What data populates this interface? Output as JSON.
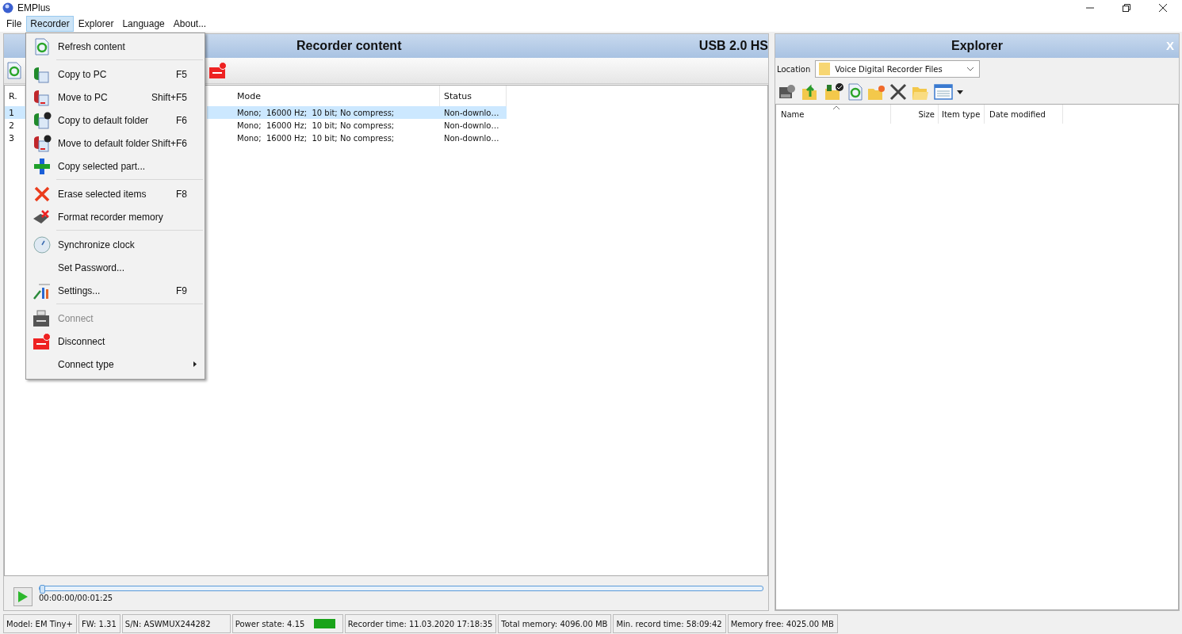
{
  "window": {
    "title": "EMPlus"
  },
  "menu_bar": [
    {
      "label": "File",
      "selected": false
    },
    {
      "label": "Recorder",
      "selected": true
    },
    {
      "label": "Explorer",
      "selected": false
    },
    {
      "label": "Language",
      "selected": false
    },
    {
      "label": "About...",
      "selected": false
    }
  ],
  "recorder_menu": [
    {
      "kind": "item",
      "label": "Refresh content",
      "disabled": false
    },
    {
      "kind": "separator"
    },
    {
      "kind": "item",
      "label": "Copy to PC",
      "shortcut": "F5",
      "disabled": false
    },
    {
      "kind": "item",
      "label": "Move to PC",
      "shortcut": "Shift+F5",
      "disabled": false
    },
    {
      "kind": "item",
      "label": "Copy to default folder",
      "shortcut": "F6",
      "disabled": false
    },
    {
      "kind": "item",
      "label": "Move to default folder",
      "shortcut": "Shift+F6",
      "disabled": false
    },
    {
      "kind": "item",
      "label": "Copy selected part...",
      "disabled": false
    },
    {
      "kind": "separator"
    },
    {
      "kind": "item",
      "label": "Erase selected items",
      "shortcut": "F8",
      "disabled": false
    },
    {
      "kind": "item",
      "label": "Format recorder memory",
      "disabled": false
    },
    {
      "kind": "separator"
    },
    {
      "kind": "item",
      "label": "Synchronize clock",
      "disabled": false
    },
    {
      "kind": "item",
      "label": "Set Password...",
      "disabled": false
    },
    {
      "kind": "item",
      "label": "Settings...",
      "shortcut": "F9",
      "disabled": false
    },
    {
      "kind": "separator"
    },
    {
      "kind": "item",
      "label": "Connect",
      "disabled": true
    },
    {
      "kind": "item",
      "label": "Disconnect",
      "disabled": false
    },
    {
      "kind": "item",
      "label": "Connect type",
      "disabled": false,
      "submenu": true
    }
  ],
  "recorder_panel": {
    "title": "Recorder content",
    "connection": "USB 2.0 HS",
    "table": {
      "columns": [
        "R.",
        "Mode",
        "Status"
      ],
      "rows": [
        {
          "index": "1",
          "mode": "Mono;  16000 Hz;  10 bit; No compress;",
          "status": "Non-downlo…",
          "selected": true
        },
        {
          "index": "2",
          "mode": "Mono;  16000 Hz;  10 bit; No compress;",
          "status": "Non-downlo…",
          "selected": false
        },
        {
          "index": "3",
          "mode": "Mono;  16000 Hz;  10 bit; No compress;",
          "status": "Non-downlo…",
          "selected": false
        }
      ]
    },
    "player": {
      "time": "00:00:00/00:01:25",
      "level": 0
    }
  },
  "explorer_panel": {
    "title": "Explorer",
    "close": "X",
    "location_label": "Location",
    "location": "Voice Digital Recorder Files",
    "columns": [
      "Name",
      "Size",
      "Item type",
      "Date modified"
    ]
  },
  "status_bar": [
    "Model: EM Tiny+",
    "FW: 1.31",
    "S/N: ASWMUX244282",
    "Power state: 4.15",
    "Recorder time: 11.03.2020 17:18:35",
    "Total memory: 4096.00 MB",
    "Min. record time: 58:09:42",
    "Memory free: 4025.00 MB"
  ]
}
